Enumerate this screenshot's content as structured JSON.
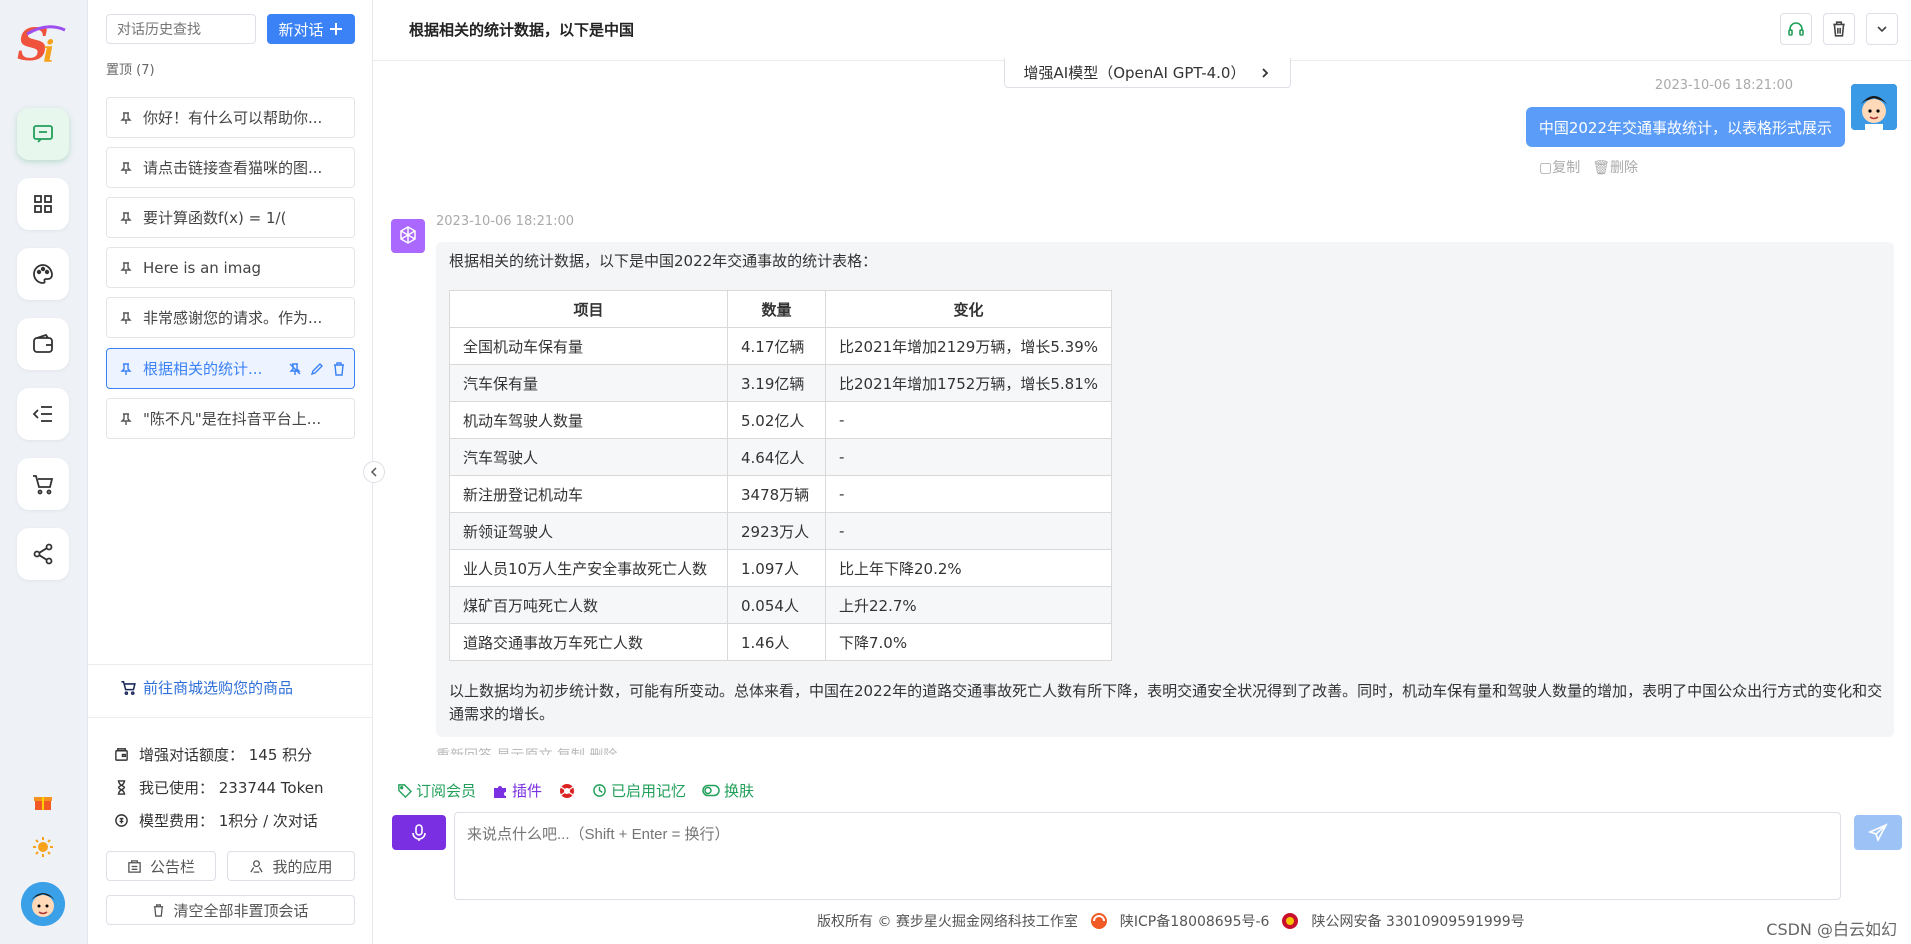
{
  "sidebar": {
    "search_placeholder": "对话历史查找",
    "new_chat_label": "新对话",
    "pinned_label": "置顶 (7)",
    "conversations": [
      {
        "title": "你好！有什么可以帮助你..."
      },
      {
        "title": "请点击链接查看猫咪的图..."
      },
      {
        "title": "要计算函数f(x) = 1/("
      },
      {
        "title": "Here is an imag"
      },
      {
        "title": "非常感谢您的请求。作为..."
      },
      {
        "title": "根据相关的统计..."
      },
      {
        "title": "\"陈不凡\"是在抖音平台上..."
      }
    ],
    "shop_link": "前往商城选购您的商品",
    "stats": {
      "quota": "增强对话额度： 145 积分",
      "used": "我已使用： 233744 Token",
      "cost": "模型费用： 1积分 / 次对话"
    },
    "notice_button": "公告栏",
    "apps_button": "我的应用",
    "clear_button": "清空全部非置顶会话"
  },
  "header": {
    "title": "根据相关的统计数据，以下是中国"
  },
  "model_selector": "增强AI模型（OpenAI GPT-4.0）",
  "user_message": {
    "timestamp": "2023-10-06 18:21:00",
    "text": "中国2022年交通事故统计，以表格形式展示",
    "copy_label": "复制",
    "delete_label": "删除"
  },
  "bot_message": {
    "timestamp": "2023-10-06 18:21:00",
    "intro": "根据相关的统计数据，以下是中国2022年交通事故的统计表格：",
    "table_headers": [
      "项目",
      "数量",
      "变化"
    ],
    "table_rows": [
      [
        "全国机动车保有量",
        "4.17亿辆",
        "比2021年增加2129万辆，增长5.39%"
      ],
      [
        "汽车保有量",
        "3.19亿辆",
        "比2021年增加1752万辆，增长5.81%"
      ],
      [
        "机动车驾驶人数量",
        "5.02亿人",
        "-"
      ],
      [
        "汽车驾驶人",
        "4.64亿人",
        "-"
      ],
      [
        "新注册登记机动车",
        "3478万辆",
        "-"
      ],
      [
        "新领证驾驶人",
        "2923万人",
        "-"
      ],
      [
        "业人员10万人生产安全事故死亡人数",
        "1.097人",
        "比上年下降20.2%"
      ],
      [
        "煤矿百万吨死亡人数",
        "0.054人",
        "上升22.7%"
      ],
      [
        "道路交通事故万车死亡人数",
        "1.46人",
        "下降7.0%"
      ]
    ],
    "summary": "以上数据均为初步统计数，可能有所变动。总体来看，中国在2022年的道路交通事故死亡人数有所下降，表明交通安全状况得到了改善。同时，机动车保有量和驾驶人数量的增加，表明了中国公众出行方式的变化和交通需求的增长。",
    "actions": "重新回答  显示原文  复制  删除"
  },
  "options": {
    "subscribe": "订阅会员",
    "plugin": "插件",
    "memory": "已启用记忆",
    "skin": "换肤"
  },
  "input_placeholder": "来说点什么吧...（Shift + Enter = 换行）",
  "footer": {
    "copyright": "版权所有 © 赛步星火掘金网络科技工作室",
    "icp": "陕ICP备18008695号-6",
    "police": "陕公网安备 33010909591999号"
  },
  "watermark": "CSDN @白云如幻",
  "colors": {
    "accent": "#3b82f6",
    "green": "#22a05a",
    "user_bubble": "#5b9cf8",
    "purple": "#7a2fe2"
  }
}
